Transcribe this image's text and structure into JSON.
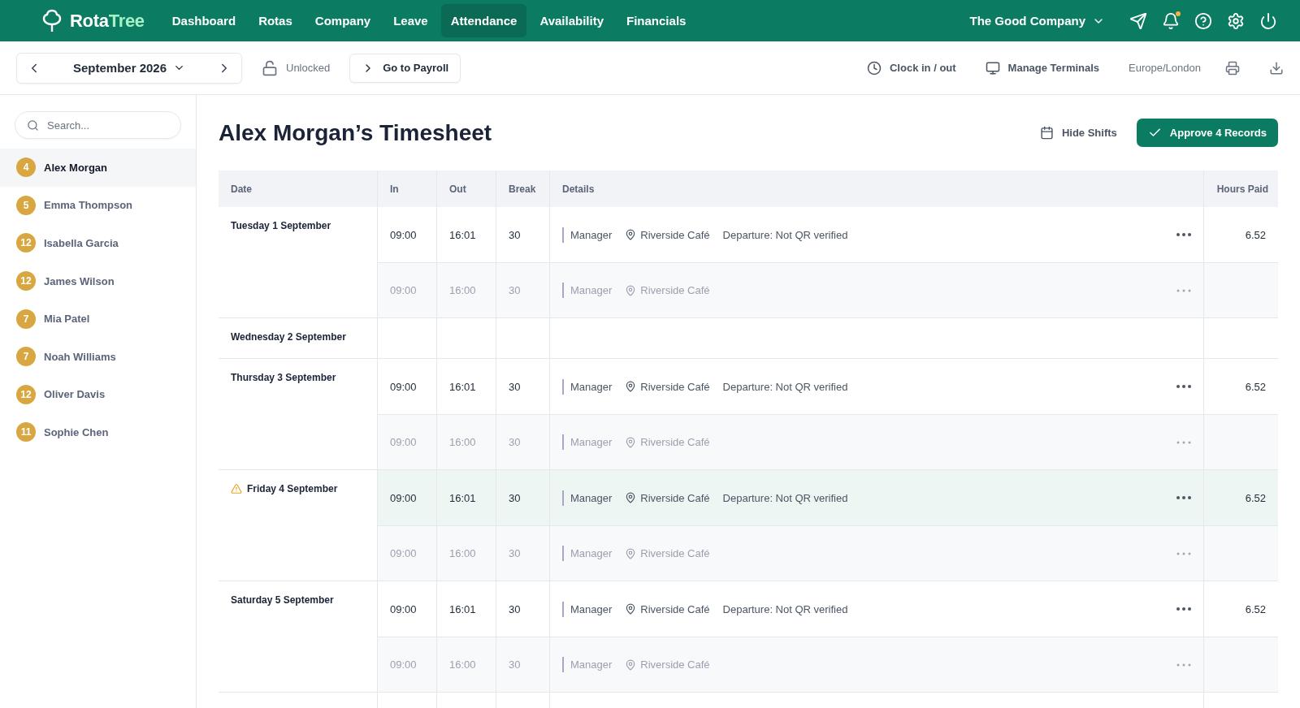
{
  "brand": {
    "part_1": "Rota",
    "part_2": "Tree"
  },
  "nav": [
    {
      "label": "Dashboard",
      "selected": false
    },
    {
      "label": "Rotas",
      "selected": false
    },
    {
      "label": "Company",
      "selected": false
    },
    {
      "label": "Leave",
      "selected": false
    },
    {
      "label": "Attendance",
      "selected": true
    },
    {
      "label": "Availability",
      "selected": false
    },
    {
      "label": "Financials",
      "selected": false
    }
  ],
  "company": "The Good Company",
  "notifications": {
    "unread": true
  },
  "toolbar": {
    "month": "September 2026",
    "lock_status": "Unlocked",
    "payroll_button": "Go to Payroll",
    "clock_button": "Clock in / out",
    "terminals_button": "Manage Terminals",
    "timezone": "Europe/London"
  },
  "search": {
    "placeholder": "Search..."
  },
  "employees": [
    {
      "count": "4",
      "name": "Alex Morgan",
      "selected": true
    },
    {
      "count": "5",
      "name": "Emma Thompson",
      "selected": false
    },
    {
      "count": "12",
      "name": "Isabella Garcia",
      "selected": false
    },
    {
      "count": "12",
      "name": "James Wilson",
      "selected": false
    },
    {
      "count": "7",
      "name": "Mia Patel",
      "selected": false
    },
    {
      "count": "7",
      "name": "Noah Williams",
      "selected": false
    },
    {
      "count": "12",
      "name": "Oliver Davis",
      "selected": false
    },
    {
      "count": "11",
      "name": "Sophie Chen",
      "selected": false
    }
  ],
  "title": "Alex Morgan’s Timesheet",
  "hide_shifts_button": "Hide Shifts",
  "approve_button": "Approve 4 Records",
  "table": {
    "columns": [
      "Date",
      "In",
      "Out",
      "Break",
      "Details",
      "Hours Paid"
    ],
    "days": [
      {
        "date": "Tuesday 1 September",
        "warning": false,
        "shifts": [
          {
            "kind": "actual",
            "highlighted": false,
            "in": "09:00",
            "out": "16:01",
            "break": "30",
            "role": "Manager",
            "location": "Riverside Café",
            "note": "Departure: Not QR verified",
            "hours": "6.52"
          },
          {
            "kind": "scheduled",
            "in": "09:00",
            "out": "16:00",
            "break": "30",
            "role": "Manager",
            "location": "Riverside Café"
          }
        ]
      },
      {
        "date": "Wednesday 2 September",
        "warning": false
      },
      {
        "date": "Thursday 3 September",
        "warning": false,
        "shifts": [
          {
            "kind": "actual",
            "highlighted": false,
            "in": "09:00",
            "out": "16:01",
            "break": "30",
            "role": "Manager",
            "location": "Riverside Café",
            "note": "Departure: Not QR verified",
            "hours": "6.52"
          },
          {
            "kind": "scheduled",
            "in": "09:00",
            "out": "16:00",
            "break": "30",
            "role": "Manager",
            "location": "Riverside Café"
          }
        ]
      },
      {
        "date": "Friday 4 September",
        "warning": true,
        "shifts": [
          {
            "kind": "actual",
            "highlighted": true,
            "in": "09:00",
            "out": "16:01",
            "break": "30",
            "role": "Manager",
            "location": "Riverside Café",
            "note": "Departure: Not QR verified",
            "hours": "6.52"
          },
          {
            "kind": "scheduled",
            "in": "09:00",
            "out": "16:00",
            "break": "30",
            "role": "Manager",
            "location": "Riverside Café"
          }
        ]
      },
      {
        "date": "Saturday 5 September",
        "warning": false,
        "shifts": [
          {
            "kind": "actual",
            "highlighted": false,
            "in": "09:00",
            "out": "16:01",
            "break": "30",
            "role": "Manager",
            "location": "Riverside Café",
            "note": "Departure: Not QR verified",
            "hours": "6.52"
          },
          {
            "kind": "scheduled",
            "in": "09:00",
            "out": "16:00",
            "break": "30",
            "role": "Manager",
            "location": "Riverside Café"
          }
        ]
      }
    ]
  }
}
